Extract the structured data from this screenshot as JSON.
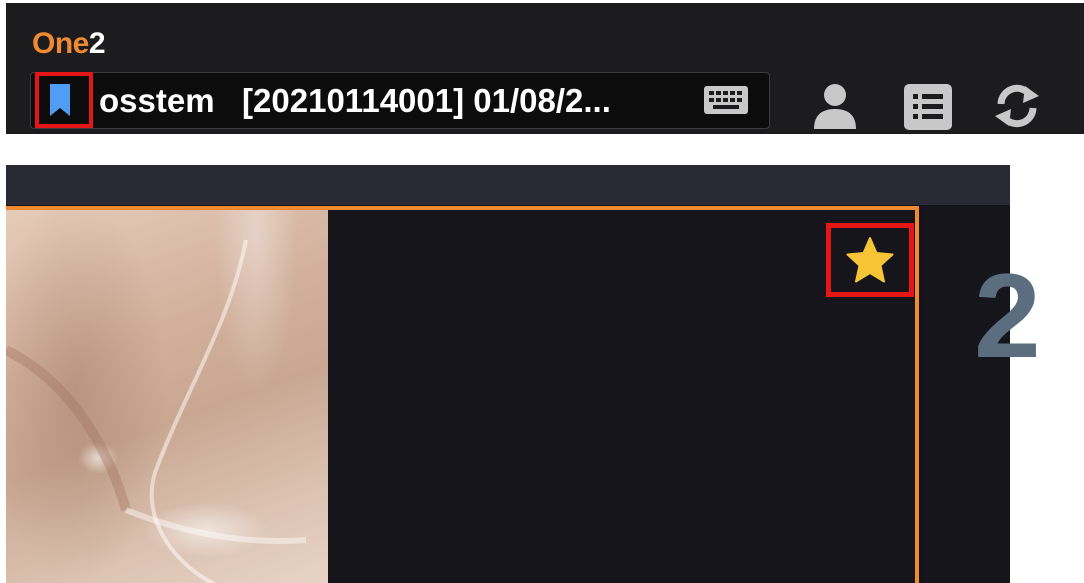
{
  "app": {
    "logo_part1": "One",
    "logo_part2": "2"
  },
  "patient": {
    "label": "osstem   [20210114001] 01/08/2..."
  },
  "icons": {
    "bookmark": "bookmark-icon",
    "keyboard": "keyboard-icon",
    "user": "user-icon",
    "list": "list-icon",
    "refresh": "refresh-icon",
    "star": "star-icon"
  },
  "viewer": {
    "next_card_number": "2"
  },
  "colors": {
    "accent": "#f08a32",
    "highlight": "#e41616",
    "bookmark": "#4f9df5",
    "star": "#f7c437",
    "toolbar_icon": "#c8c8c8"
  }
}
